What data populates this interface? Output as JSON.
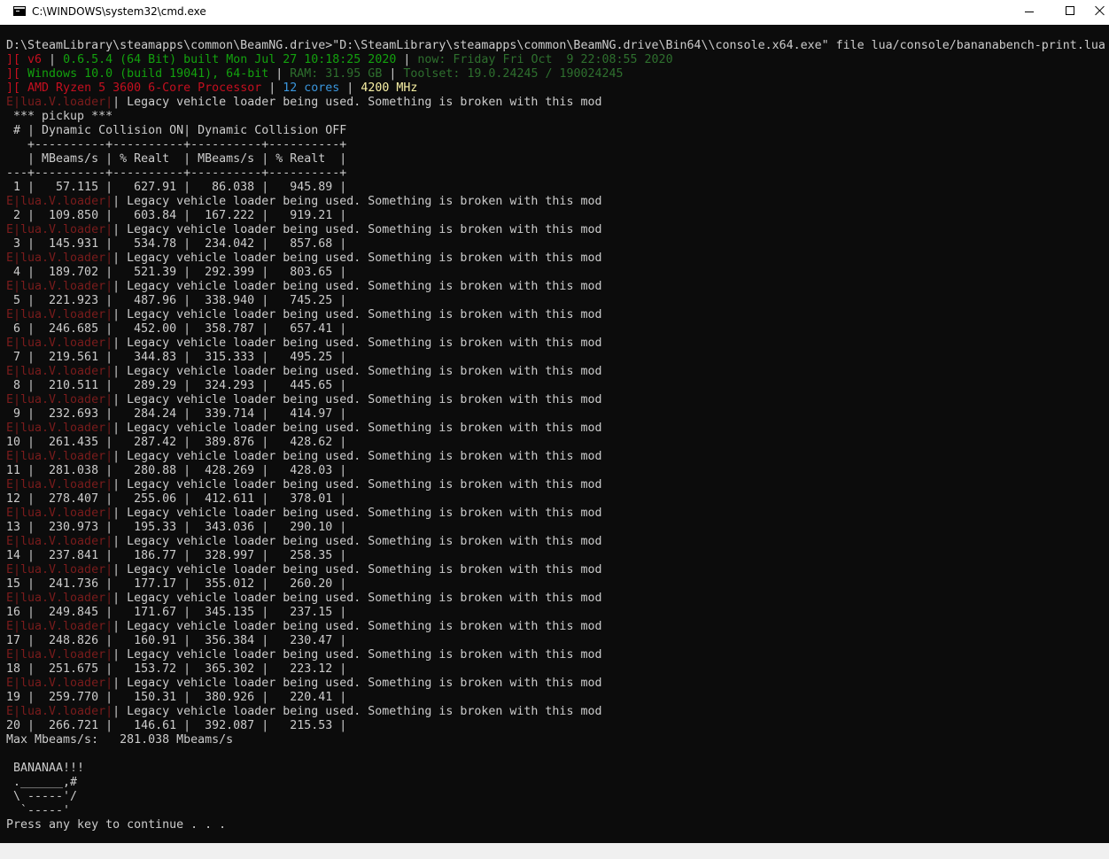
{
  "window": {
    "title": "C:\\WINDOWS\\system32\\cmd.exe"
  },
  "colors": {
    "console_bg": "#0c0c0c",
    "text": "#cccccc",
    "red": "#c50f1f",
    "green": "#13a10e",
    "cyan": "#3a96dd",
    "yellow": "#f9f1a5"
  },
  "console": {
    "command": "D:\\SteamLibrary\\steamapps\\common\\BeamNG.drive>\"D:\\SteamLibrary\\steamapps\\common\\BeamNG.drive\\Bin64\\\\console.x64.exe\" file lua/console/bananabench-print.lua",
    "info1": {
      "prefix": "][ ",
      "ver": "v6",
      "sep1": " | ",
      "build": "0.6.5.4 (64 Bit) built Mon Jul 27 10:18:25 2020",
      "sep2": " | ",
      "now": "now: Friday Fri Oct  9 22:08:55 2020"
    },
    "info2": {
      "prefix": "][ ",
      "os": "Windows 10.0 (build 19041), 64-bit",
      "sep1": " | ",
      "ram": "RAM: 31.95 GB",
      "sep2": " | ",
      "toolset": "Toolset: 19.0.24245 / 190024245"
    },
    "info3": {
      "prefix": "][ ",
      "cpu": "AMD Ryzen 5 3600 6-Core Processor",
      "sep1": " | ",
      "cores": "12 cores",
      "sep2": " | ",
      "mhz": "4200 MHz"
    },
    "warn_tag": "E|lua.V.loader|",
    "warn_msg": "| Legacy vehicle loader being used. Something is broken with this mod",
    "vehicle_header": " *** pickup ***",
    "table_header1": " # | Dynamic Collision ON| Dynamic Collision OFF",
    "table_sep1": "   +----------+----------+----------+----------+",
    "table_header2": "   | MBeams/s | % Realt  | MBeams/s | % Realt  |",
    "table_sep2": "---+----------+----------+----------+----------+",
    "rows": [
      " 1 |   57.115 |   627.91 |   86.038 |   945.89 |",
      " 2 |  109.850 |   603.84 |  167.222 |   919.21 |",
      " 3 |  145.931 |   534.78 |  234.042 |   857.68 |",
      " 4 |  189.702 |   521.39 |  292.399 |   803.65 |",
      " 5 |  221.923 |   487.96 |  338.940 |   745.25 |",
      " 6 |  246.685 |   452.00 |  358.787 |   657.41 |",
      " 7 |  219.561 |   344.83 |  315.333 |   495.25 |",
      " 8 |  210.511 |   289.29 |  324.293 |   445.65 |",
      " 9 |  232.693 |   284.24 |  339.714 |   414.97 |",
      "10 |  261.435 |   287.42 |  389.876 |   428.62 |",
      "11 |  281.038 |   280.88 |  428.269 |   428.03 |",
      "12 |  278.407 |   255.06 |  412.611 |   378.01 |",
      "13 |  230.973 |   195.33 |  343.036 |   290.10 |",
      "14 |  237.841 |   186.77 |  328.997 |   258.35 |",
      "15 |  241.736 |   177.17 |  355.012 |   260.20 |",
      "16 |  249.845 |   171.67 |  345.135 |   237.15 |",
      "17 |  248.826 |   160.91 |  356.384 |   230.47 |",
      "18 |  251.675 |   153.72 |  365.302 |   223.12 |",
      "19 |  259.770 |   150.31 |  380.926 |   220.41 |",
      "20 |  266.721 |   146.61 |  392.087 |   215.53 |"
    ],
    "max_line": "Max Mbeams/s:   281.038 Mbeams/s",
    "blank": " ",
    "banana": [
      " BANANAA!!!",
      " .______,#",
      " \\ -----'/",
      "  `-----'"
    ],
    "prompt": "Press any key to continue . . ."
  }
}
